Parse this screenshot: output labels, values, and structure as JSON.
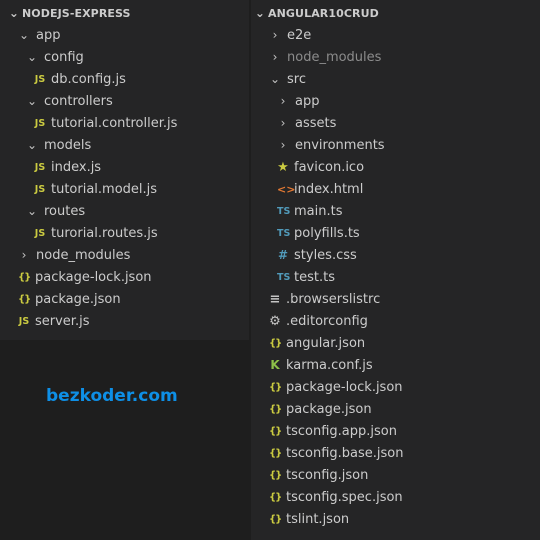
{
  "left": {
    "root": "NODEJS-EXPRESS",
    "items": [
      {
        "label": "app",
        "kind": "folder",
        "open": true
      },
      {
        "label": "config",
        "kind": "folder",
        "open": true
      },
      {
        "label": "db.config.js",
        "kind": "js",
        "icon_text": "JS"
      },
      {
        "label": "controllers",
        "kind": "folder",
        "open": true
      },
      {
        "label": "tutorial.controller.js",
        "kind": "js",
        "icon_text": "JS"
      },
      {
        "label": "models",
        "kind": "folder",
        "open": true
      },
      {
        "label": "index.js",
        "kind": "js",
        "icon_text": "JS"
      },
      {
        "label": "tutorial.model.js",
        "kind": "js",
        "icon_text": "JS"
      },
      {
        "label": "routes",
        "kind": "folder",
        "open": true
      },
      {
        "label": "turorial.routes.js",
        "kind": "js",
        "icon_text": "JS"
      },
      {
        "label": "node_modules",
        "kind": "folder",
        "open": false
      },
      {
        "label": "package-lock.json",
        "kind": "json",
        "icon_text": "{}"
      },
      {
        "label": "package.json",
        "kind": "json",
        "icon_text": "{}"
      },
      {
        "label": "server.js",
        "kind": "js",
        "icon_text": "JS"
      }
    ]
  },
  "right": {
    "root": "ANGULAR10CRUD",
    "items": [
      {
        "label": "e2e",
        "kind": "folder",
        "open": false
      },
      {
        "label": "node_modules",
        "kind": "folder",
        "open": false
      },
      {
        "label": "src",
        "kind": "folder",
        "open": true
      },
      {
        "label": "app",
        "kind": "folder",
        "open": false
      },
      {
        "label": "assets",
        "kind": "folder",
        "open": false
      },
      {
        "label": "environments",
        "kind": "folder",
        "open": false
      },
      {
        "label": "favicon.ico",
        "kind": "star",
        "icon_text": "★"
      },
      {
        "label": "index.html",
        "kind": "html",
        "icon_text": "<>"
      },
      {
        "label": "main.ts",
        "kind": "ts",
        "icon_text": "TS"
      },
      {
        "label": "polyfills.ts",
        "kind": "ts",
        "icon_text": "TS"
      },
      {
        "label": "styles.css",
        "kind": "css",
        "icon_text": "#"
      },
      {
        "label": "test.ts",
        "kind": "ts",
        "icon_text": "TS"
      },
      {
        "label": ".browserslistrc",
        "kind": "lines",
        "icon_text": "≡"
      },
      {
        "label": ".editorconfig",
        "kind": "gear",
        "icon_text": "⚙"
      },
      {
        "label": "angular.json",
        "kind": "json",
        "icon_text": "{}"
      },
      {
        "label": "karma.conf.js",
        "kind": "karma",
        "icon_text": "K"
      },
      {
        "label": "package-lock.json",
        "kind": "json",
        "icon_text": "{}"
      },
      {
        "label": "package.json",
        "kind": "json",
        "icon_text": "{}"
      },
      {
        "label": "tsconfig.app.json",
        "kind": "json",
        "icon_text": "{}"
      },
      {
        "label": "tsconfig.base.json",
        "kind": "json",
        "icon_text": "{}"
      },
      {
        "label": "tsconfig.json",
        "kind": "json",
        "icon_text": "{}"
      },
      {
        "label": "tsconfig.spec.json",
        "kind": "json",
        "icon_text": "{}"
      },
      {
        "label": "tslint.json",
        "kind": "json",
        "icon_text": "{}"
      }
    ]
  },
  "watermark": "bezkoder.com",
  "icons": {
    "chevron_open": "⌄",
    "chevron_closed": "›"
  },
  "colors": {
    "js": "#cbcb41",
    "ts": "#519aba",
    "json": "#cbcb41",
    "html": "#e37933",
    "css": "#519aba",
    "karma": "#8dc149",
    "watermark": "#0e8fe6"
  }
}
